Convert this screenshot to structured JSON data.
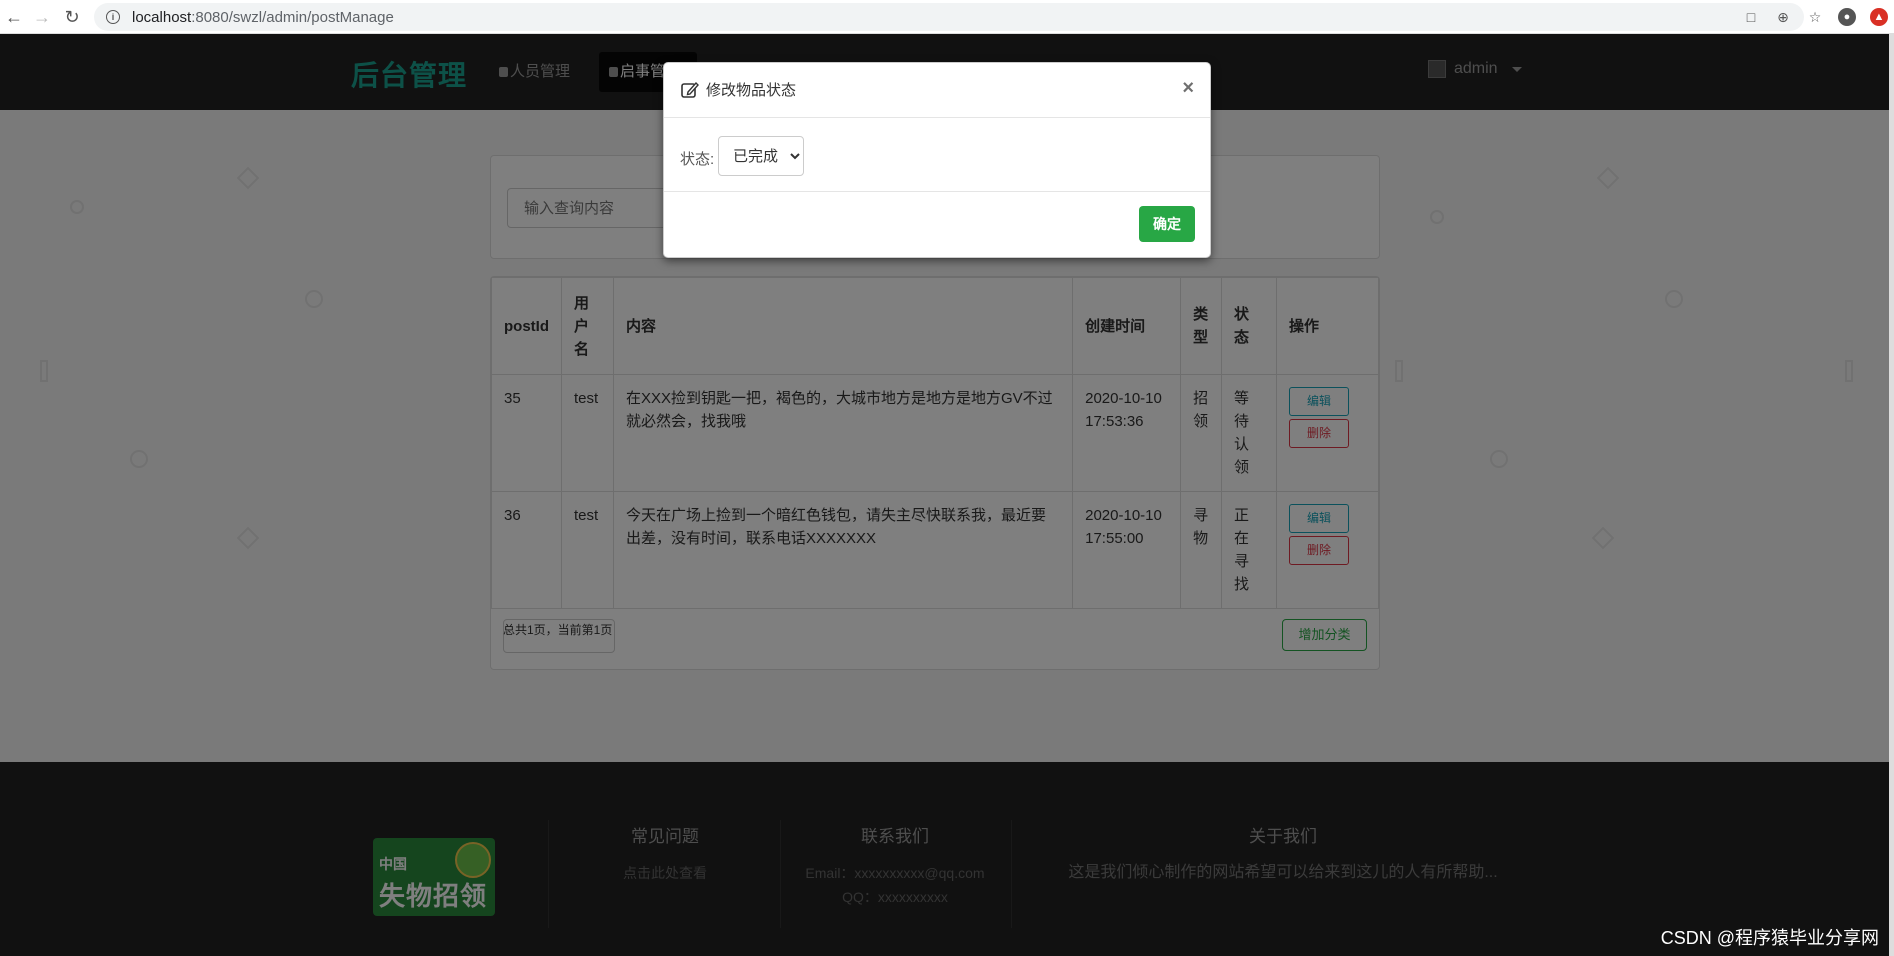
{
  "browser": {
    "url_host": "localhost",
    "url_path": ":8080/swzl/admin/postManage"
  },
  "navbar": {
    "brand": "后台管理",
    "items": [
      {
        "label": "人员管理"
      },
      {
        "label": "启事管"
      }
    ],
    "user": "admin"
  },
  "search": {
    "placeholder": "输入查询内容"
  },
  "table": {
    "headers": [
      "postId",
      "用户名",
      "内容",
      "创建时间",
      "类型",
      "状态",
      "操作"
    ],
    "rows": [
      {
        "postId": "35",
        "user": "test",
        "content": "在XXX捡到钥匙一把，褐色的，大城市地方是地方是地方GV不过就必然会，找我哦",
        "created": "2020-10-10 17:53:36",
        "type": "招领",
        "status": "等待认领"
      },
      {
        "postId": "36",
        "user": "test",
        "content": "今天在广场上捡到一个暗红色钱包，请失主尽快联系我，最近要出差，没有时间，联系电话XXXXXXX",
        "created": "2020-10-10 17:55:00",
        "type": "寻物",
        "status": "正在寻找"
      }
    ],
    "edit_label": "编辑",
    "delete_label": "删除",
    "pager_text": "总共1页，当前第1页",
    "add_label": "增加分类"
  },
  "modal": {
    "title": "修改物品状态",
    "close": "×",
    "status_label": "状态:",
    "status_value": "已完成",
    "confirm_label": "确定"
  },
  "footer": {
    "logo_top": "中国",
    "logo_main": "失物招领",
    "faq_title": "常见问题",
    "faq_link": "点击此处查看",
    "contact_title": "联系我们",
    "contact_email": "Email：xxxxxxxxxx@qq.com",
    "contact_qq": "QQ：xxxxxxxxxx",
    "about_title": "关于我们",
    "about_text": "这是我们倾心制作的网站希望可以给来到这儿的人有所帮助..."
  },
  "watermark": "CSDN @程序猿毕业分享网",
  "colors": {
    "brand": "#1aa390",
    "navbar": "#222222",
    "confirm": "#28a745",
    "edit": "#17a2b8",
    "delete": "#dc3545"
  }
}
